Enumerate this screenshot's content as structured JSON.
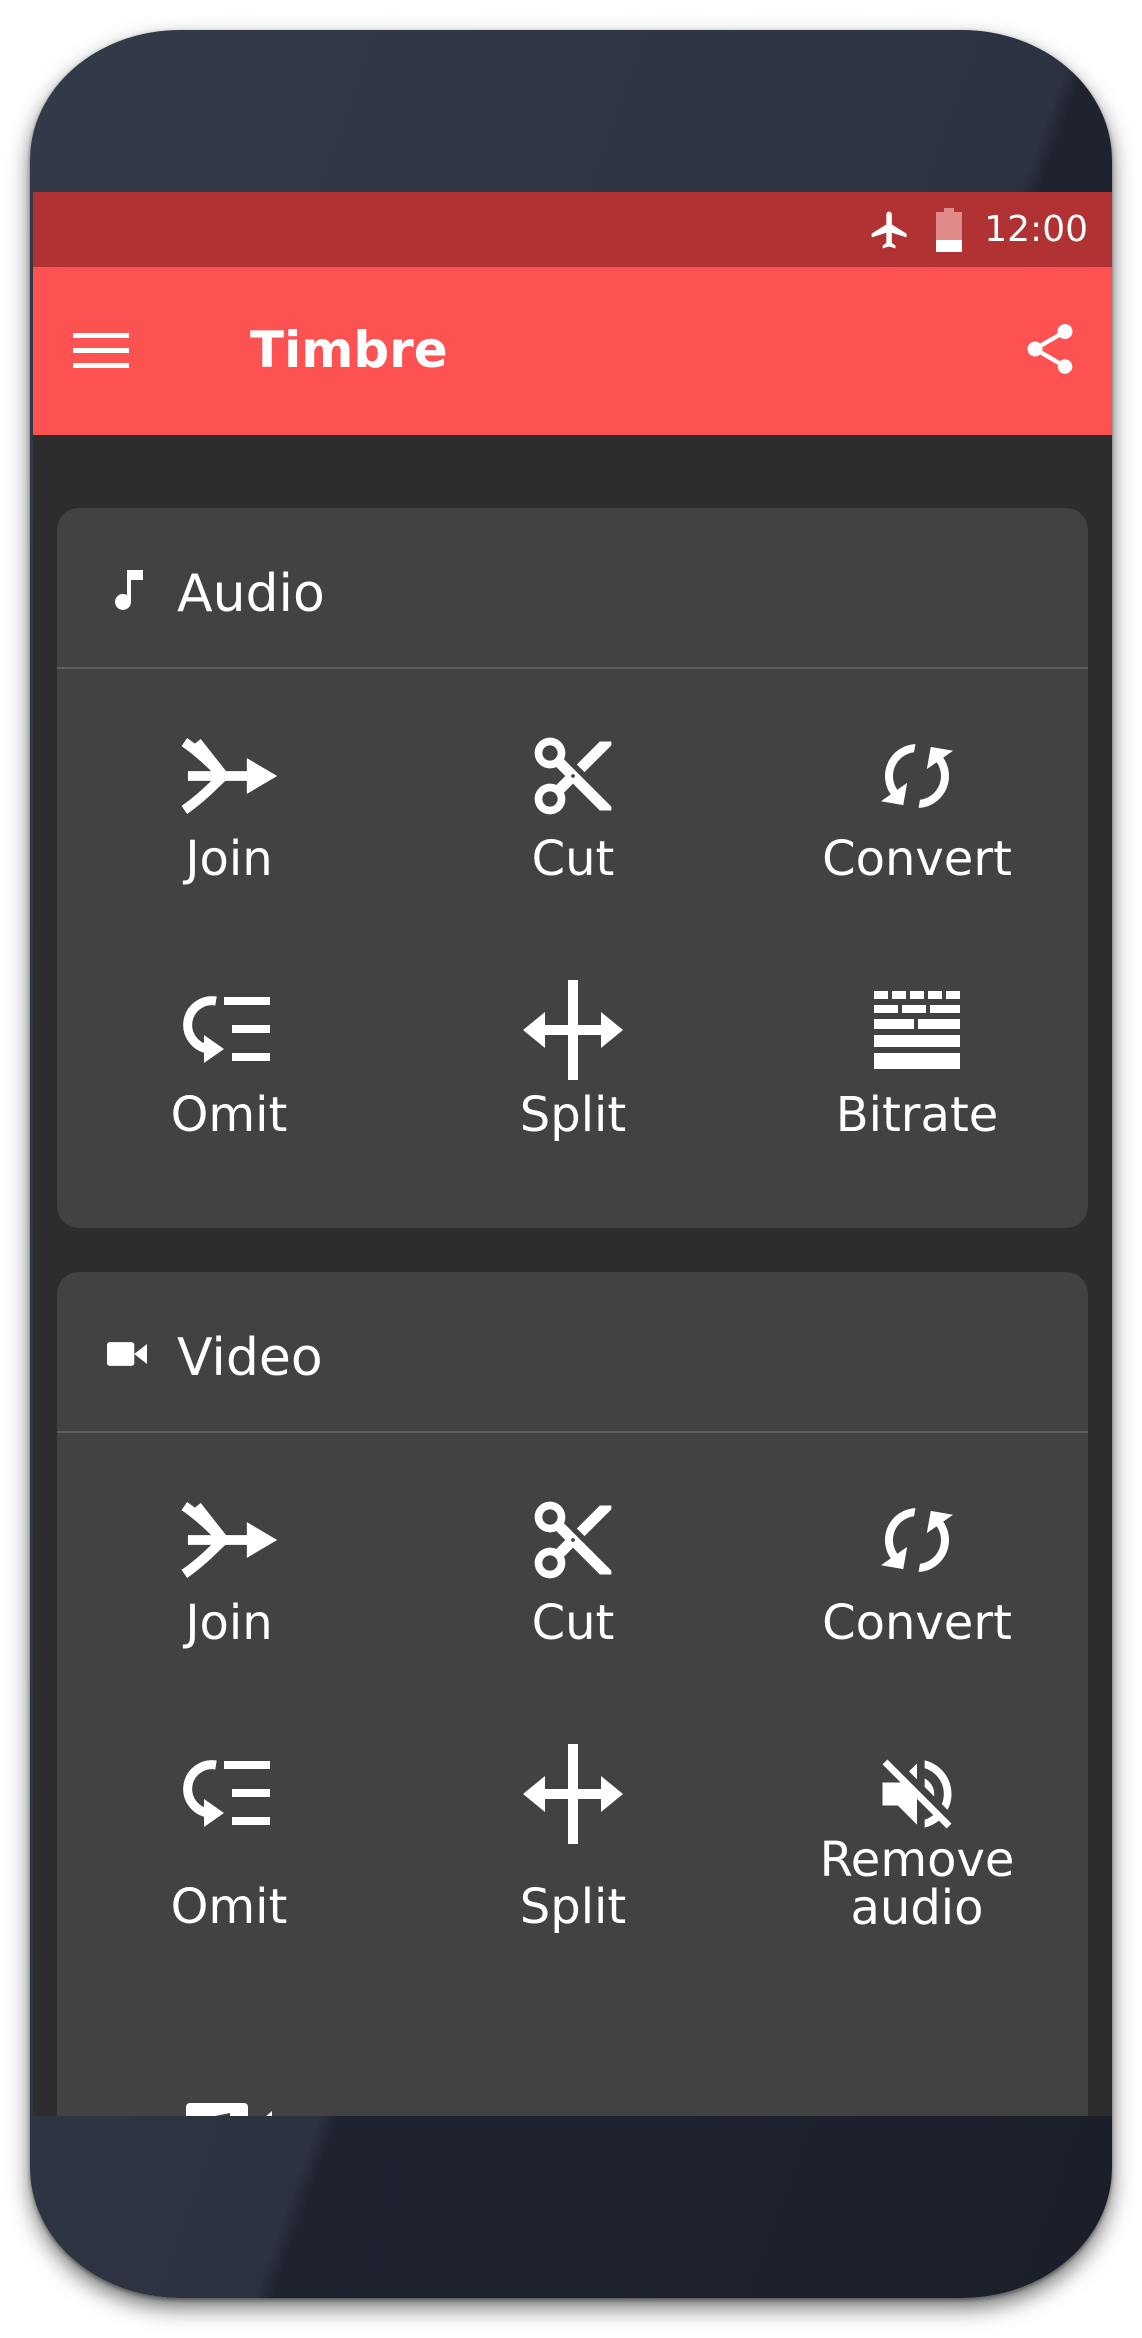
{
  "status_bar": {
    "time": "12:00",
    "icons": [
      "airplane-icon",
      "battery-icon"
    ]
  },
  "app_bar": {
    "title": "Timbre",
    "menu_icon": "hamburger-menu-icon",
    "share_icon": "share-icon"
  },
  "colors": {
    "status_bar": "#b13232",
    "app_bar": "#fd5252",
    "background": "#2d2d2d",
    "card": "#424242"
  },
  "audio_card": {
    "title": "Audio",
    "icon": "music-note-icon",
    "tools": [
      {
        "label": "Join",
        "icon": "merge-arrow-icon"
      },
      {
        "label": "Cut",
        "icon": "scissors-icon"
      },
      {
        "label": "Convert",
        "icon": "sync-icon"
      },
      {
        "label": "Omit",
        "icon": "omit-icon"
      },
      {
        "label": "Split",
        "icon": "split-arrows-icon"
      },
      {
        "label": "Bitrate",
        "icon": "bitrate-icon"
      }
    ]
  },
  "video_card": {
    "title": "Video",
    "icon": "videocam-icon",
    "tools": [
      {
        "label": "Join",
        "icon": "merge-arrow-icon"
      },
      {
        "label": "Cut",
        "icon": "scissors-icon"
      },
      {
        "label": "Convert",
        "icon": "sync-icon"
      },
      {
        "label": "Omit",
        "icon": "omit-icon"
      },
      {
        "label": "Split",
        "icon": "split-arrows-icon"
      },
      {
        "label": "Remove\naudio",
        "icon": "volume-off-icon"
      },
      {
        "label": "",
        "icon": "video-music-icon"
      }
    ]
  }
}
